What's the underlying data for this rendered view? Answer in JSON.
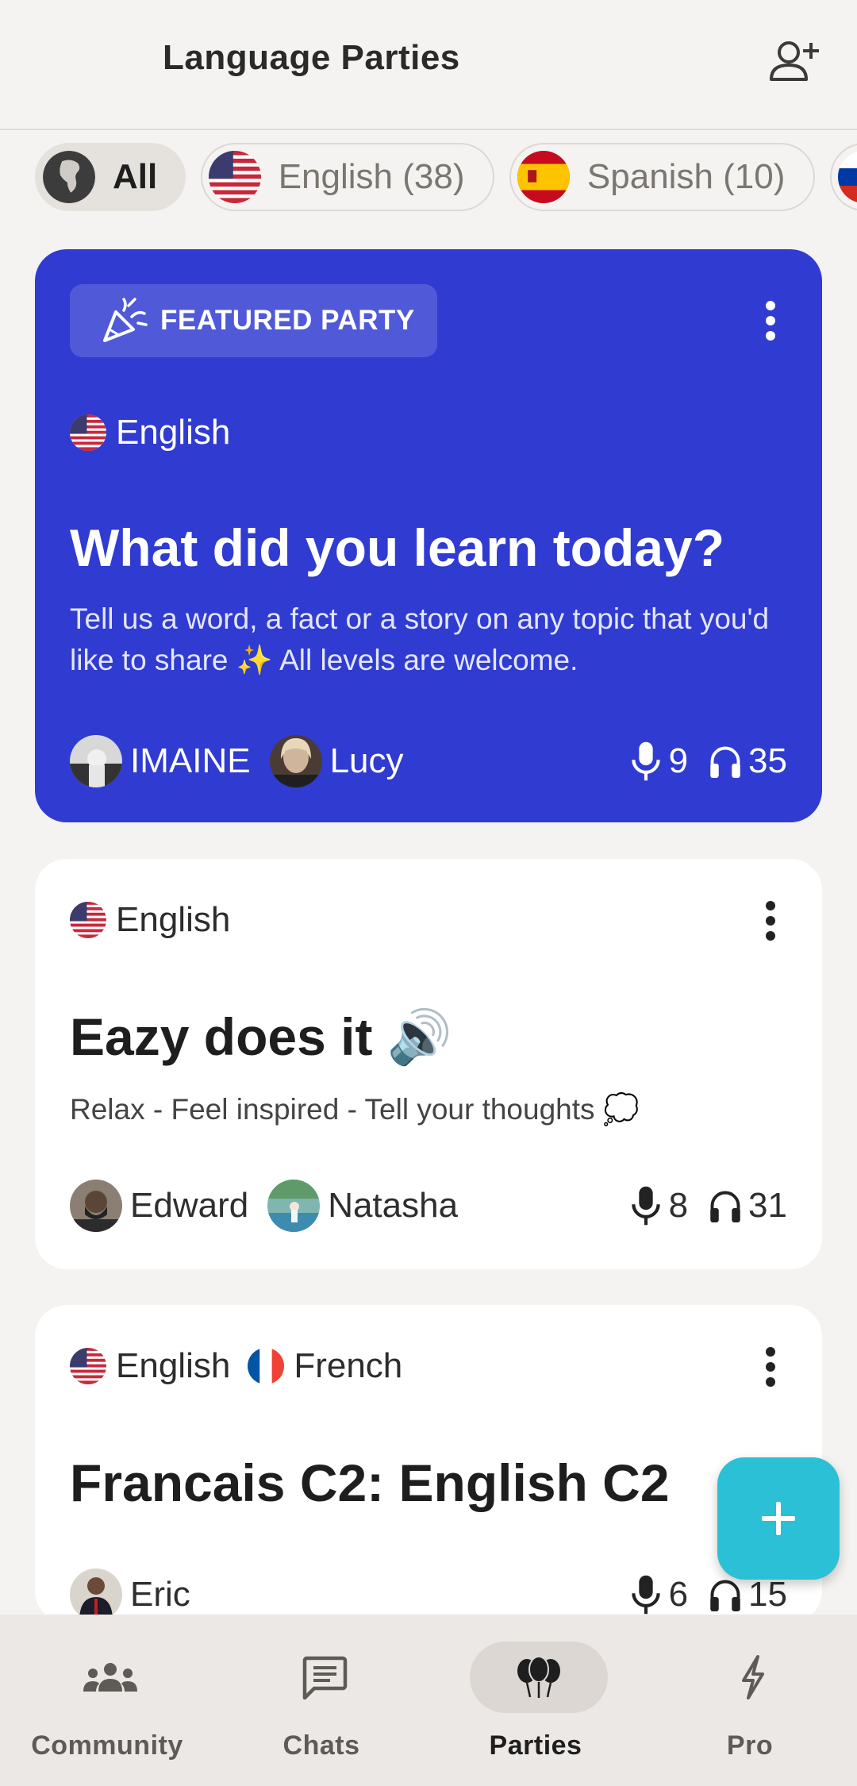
{
  "header": {
    "title": "Language Parties",
    "add_friend_icon": "person-add-icon"
  },
  "filters": [
    {
      "label": "All",
      "icon": "globe-africa-icon",
      "active": true
    },
    {
      "label": "English (38)",
      "icon": "us-flag-icon"
    },
    {
      "label": "Spanish (10)",
      "icon": "spain-flag-icon"
    },
    {
      "label": "",
      "icon": "russia-flag-icon"
    }
  ],
  "featured": {
    "badge": "FEATURED PARTY",
    "badge_icon": "party-popper-icon",
    "language": "English",
    "title": "What did you learn today?",
    "description": "Tell us a word, a fact or a story on any topic that you'd like to share ✨ All levels are welcome.",
    "hosts": [
      "IMAINE",
      "Lucy"
    ],
    "speakers": "9",
    "listeners": "35"
  },
  "parties": [
    {
      "languages": [
        "English"
      ],
      "title": "Eazy does it 🔊",
      "description": "Relax - Feel inspired - Tell your thoughts 💭",
      "hosts": [
        "Edward",
        "Natasha"
      ],
      "speakers": "8",
      "listeners": "31"
    },
    {
      "languages": [
        "English",
        "French"
      ],
      "title": "Francais C2: English C2",
      "hosts": [
        "Eric"
      ],
      "speakers": "6",
      "listeners": "15"
    }
  ],
  "fab": {
    "icon": "plus-icon"
  },
  "nav": [
    {
      "label": "Community",
      "icon": "people-icon"
    },
    {
      "label": "Chats",
      "icon": "chat-icon"
    },
    {
      "label": "Parties",
      "icon": "balloons-icon",
      "active": true
    },
    {
      "label": "Pro",
      "icon": "bolt-icon"
    }
  ],
  "colors": {
    "featured_bg": "#2f3bd1",
    "fab": "#2cc0d6",
    "background": "#f5f3f1"
  }
}
